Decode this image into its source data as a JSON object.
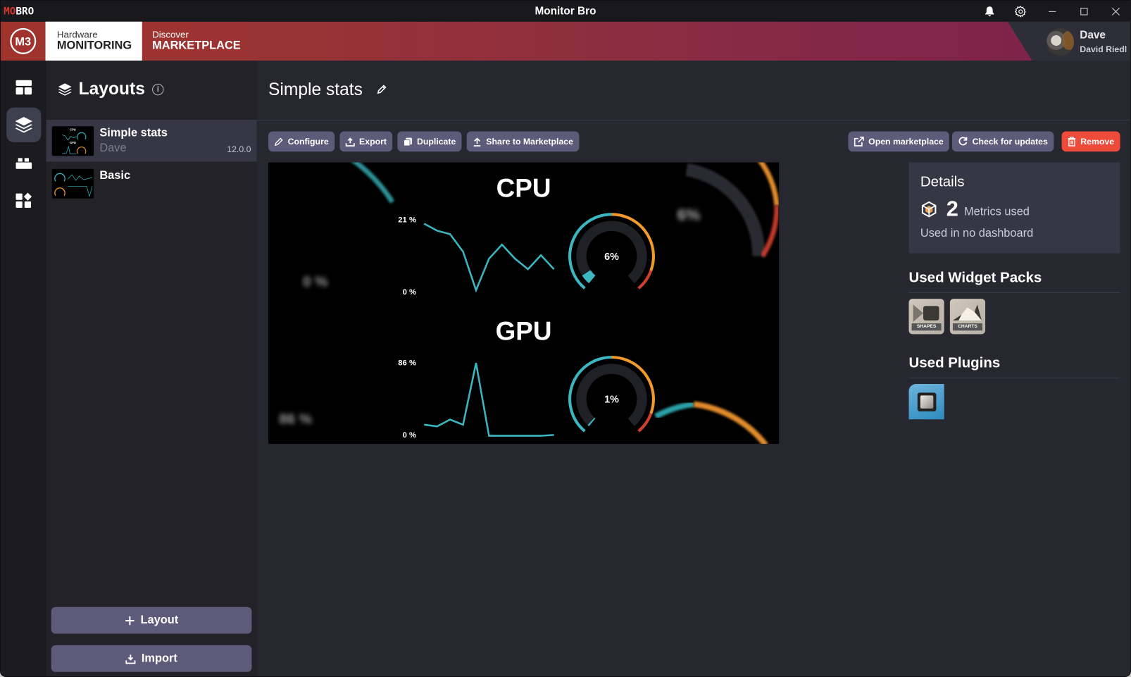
{
  "window": {
    "app_title": "Monitor Bro",
    "logo_part1": "MO",
    "logo_part2": "BRO"
  },
  "titlebar_icons": [
    "bell-icon",
    "gear-icon",
    "minimize-icon",
    "maximize-icon",
    "close-icon"
  ],
  "header": {
    "brand_mark": "M3",
    "tabs": [
      {
        "small": "Hardware",
        "big": "MONITORING",
        "active": true
      },
      {
        "small": "Discover",
        "big": "MARKETPLACE",
        "active": false
      }
    ],
    "user": {
      "first_name": "Dave",
      "full_name": "David Riedl"
    },
    "gradient_colors": [
      "#a0332c",
      "#7e2449"
    ]
  },
  "rail": {
    "items": [
      {
        "name": "dashboards",
        "icon": "dashboard-icon",
        "active": false
      },
      {
        "name": "layouts",
        "icon": "layers-icon",
        "active": true
      },
      {
        "name": "widgets",
        "icon": "widget-blocks-icon",
        "active": false
      },
      {
        "name": "plugins",
        "icon": "apps-icon",
        "active": false
      }
    ]
  },
  "layouts_panel": {
    "title": "Layouts",
    "items": [
      {
        "name": "Simple stats",
        "author": "Dave",
        "version": "12.0.0",
        "selected": true
      },
      {
        "name": "Basic",
        "author": "",
        "version": "",
        "selected": false
      }
    ],
    "add_button": "Layout",
    "import_button": "Import"
  },
  "main": {
    "title": "Simple stats",
    "actions_left": [
      "Configure",
      "Export",
      "Duplicate",
      "Share to Marketplace"
    ],
    "actions_right": [
      "Open marketplace",
      "Check for updates",
      "Remove"
    ],
    "accent_color": "#5d5a7a",
    "danger_color": "#ef4b3a"
  },
  "preview": {
    "cpu": {
      "label": "CPU",
      "axis_max": "21 %",
      "axis_min": "0 %",
      "gauge_value": "6%",
      "gauge_fraction": 0.06,
      "series": [
        20,
        18,
        17,
        12,
        1,
        10,
        14,
        10,
        7,
        11,
        7
      ]
    },
    "gpu": {
      "label": "GPU",
      "axis_max": "86 %",
      "axis_min": "0 %",
      "gauge_value": "1%",
      "gauge_fraction": 0.01,
      "series": [
        14,
        12,
        20,
        14,
        86,
        1,
        1,
        1,
        1,
        1,
        2
      ]
    },
    "blurred_left_top": "0 %",
    "blurred_left_bottom": "86 %",
    "blurred_right_top": "6%",
    "line_color": "#3cb6c0",
    "gauge_colors": [
      "#3cb6c0",
      "#f09a2e",
      "#d0402e"
    ]
  },
  "details": {
    "title": "Details",
    "metrics_count": "2",
    "metrics_label": "Metrics used",
    "usage": "Used in no dashboard"
  },
  "widget_packs": {
    "title": "Used Widget Packs",
    "items": [
      {
        "label": "SHAPES"
      },
      {
        "label": "CHARTS"
      }
    ]
  },
  "plugins": {
    "title": "Used Plugins",
    "items": [
      {
        "name": "hardware-plugin"
      }
    ]
  }
}
